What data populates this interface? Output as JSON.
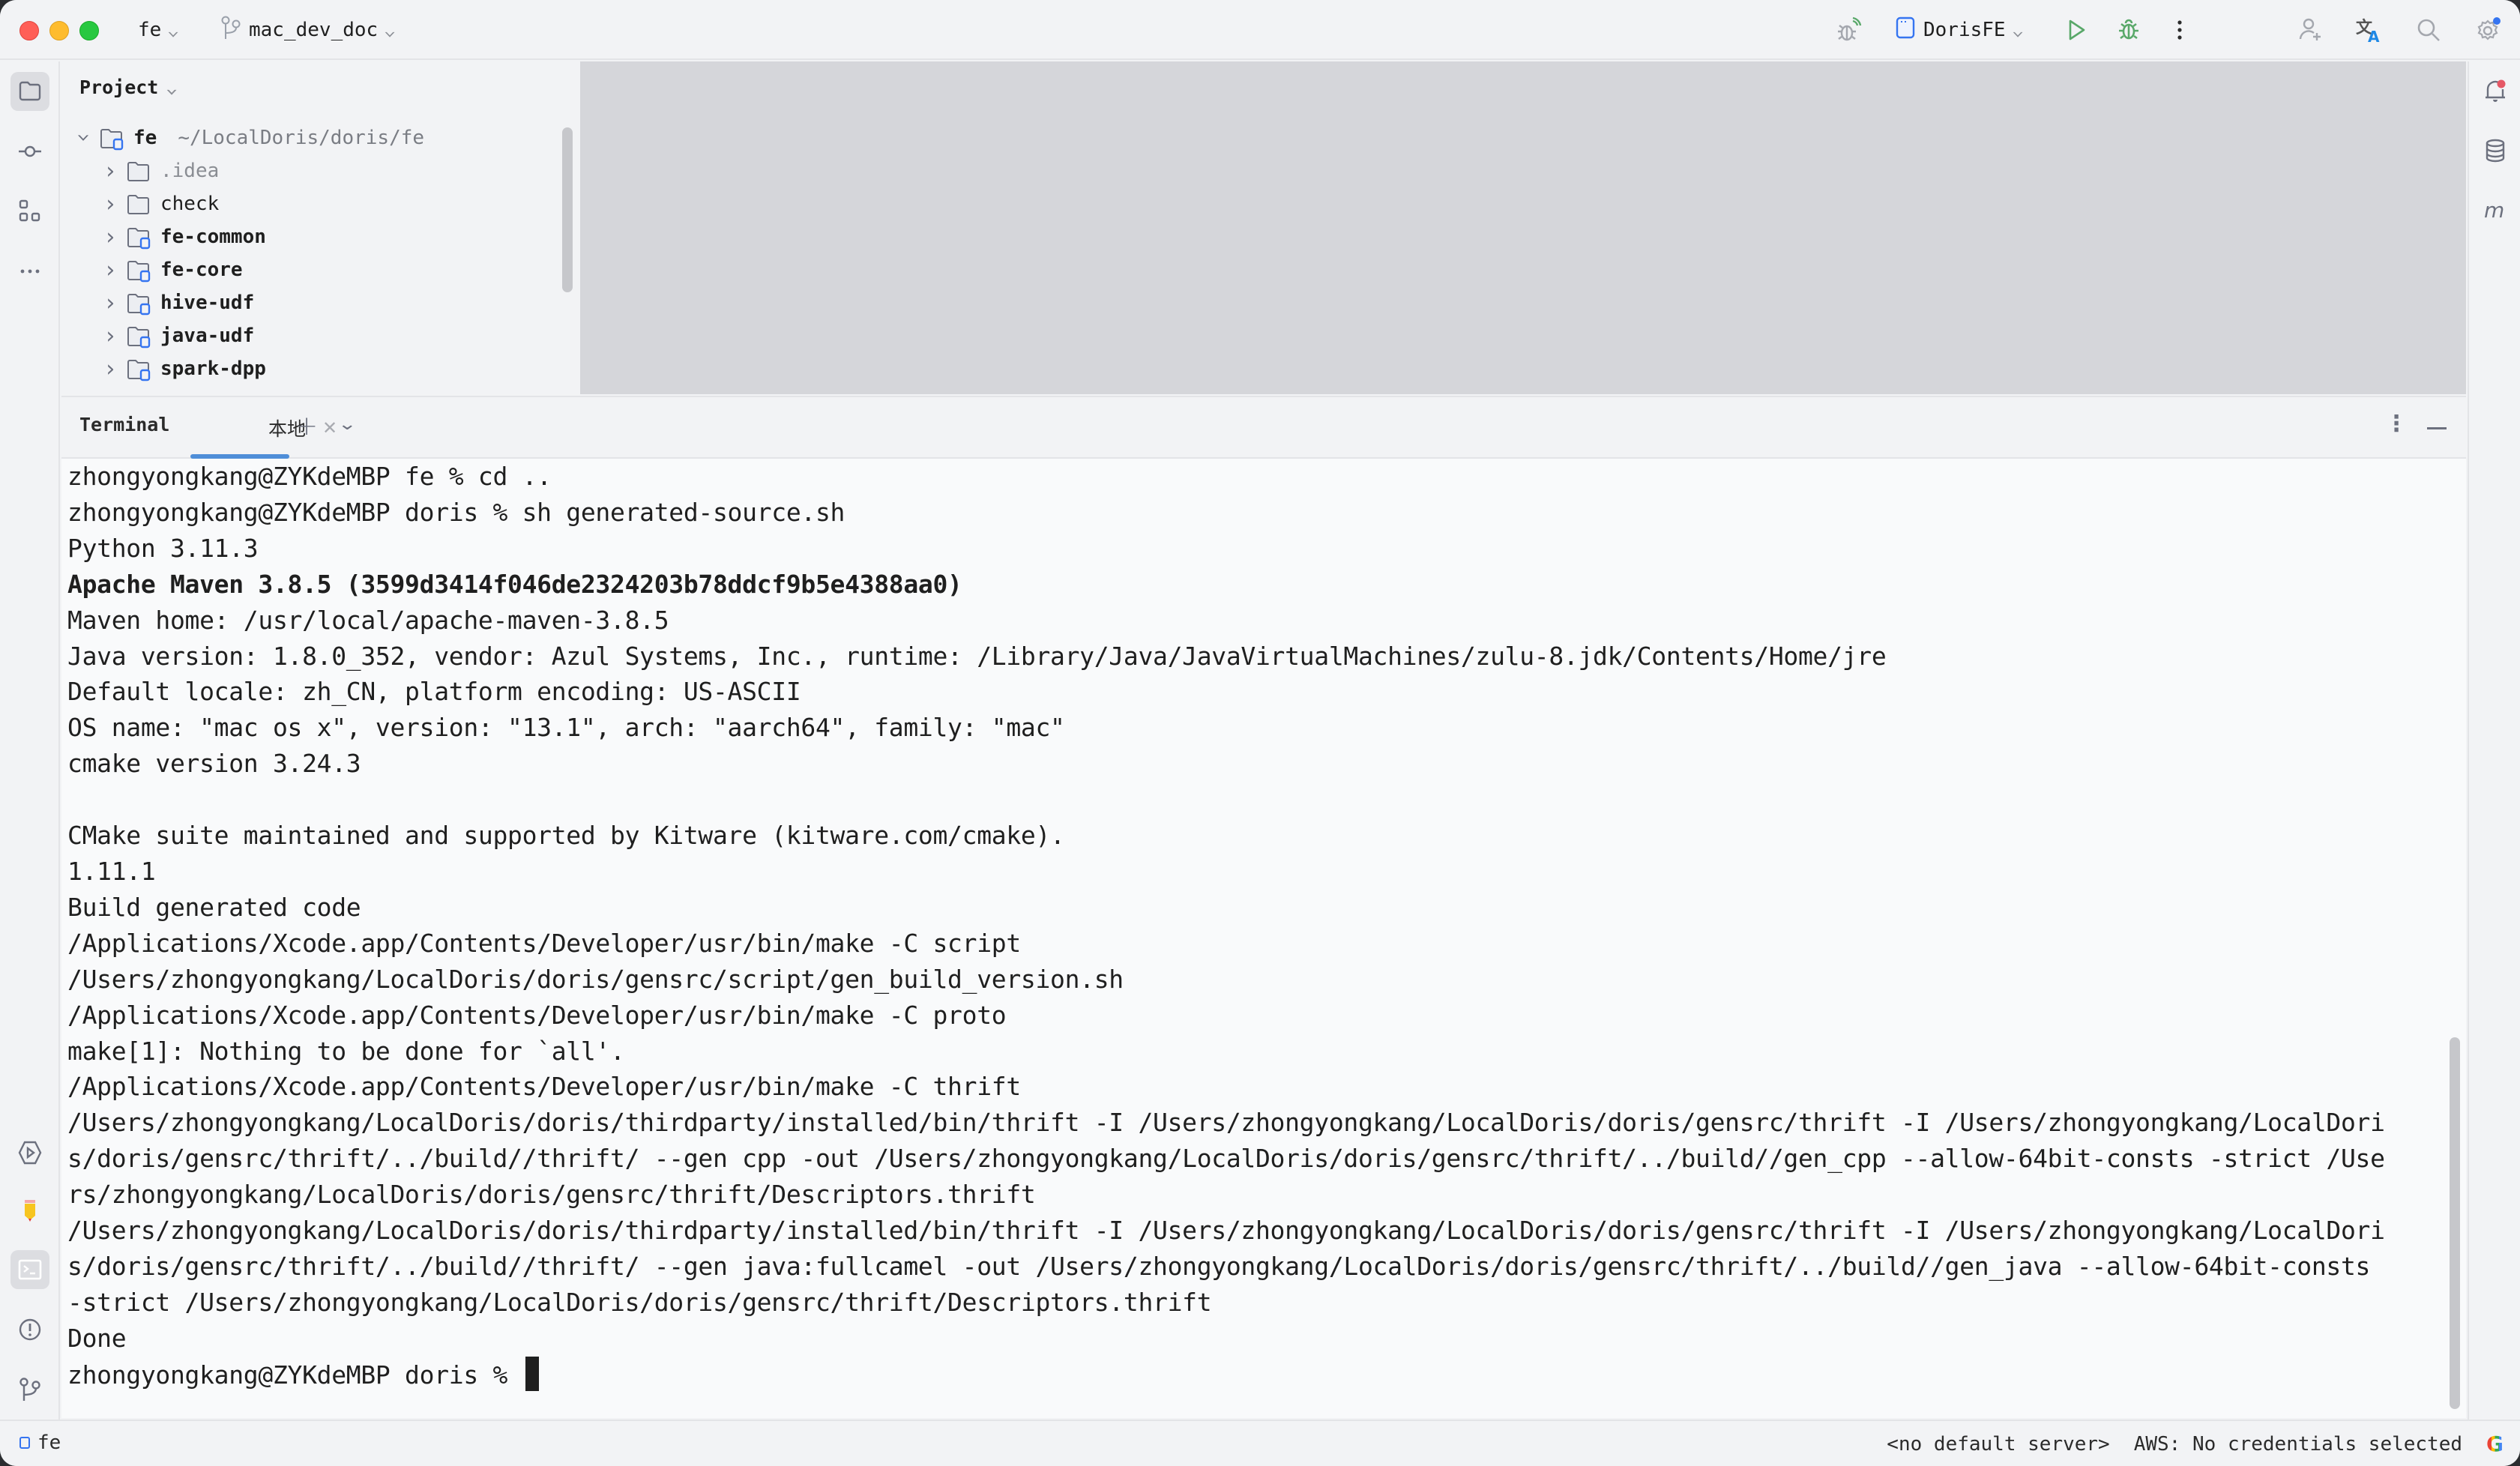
{
  "titlebar": {
    "project_name": "fe",
    "branch_name": "mac_dev_doc",
    "run_config": "DorisFE"
  },
  "toolbar_icons": [
    "debug-remote-icon",
    "run-config-icon",
    "run-icon",
    "debug-icon",
    "more-icon",
    "add-user-icon",
    "translate-icon",
    "search-icon",
    "settings-icon"
  ],
  "left_strip": {
    "top": [
      "project-icon",
      "commit-icon",
      "structure-icon",
      "more-tools-icon"
    ],
    "bottom": [
      "services-icon",
      "plugin-pencil-icon",
      "terminal-icon",
      "problems-icon",
      "git-icon"
    ]
  },
  "right_strip": [
    "notifications-icon",
    "database-icon",
    "maven-icon"
  ],
  "project_panel": {
    "title": "Project",
    "tree": [
      {
        "name": "fe",
        "hint": "~/LocalDoris/doris/fe",
        "expanded": true,
        "level": 0,
        "style": "bold",
        "module": true
      },
      {
        "name": ".idea",
        "level": 1,
        "style": "muted",
        "module": false
      },
      {
        "name": "check",
        "level": 1,
        "style": "normal",
        "module": false
      },
      {
        "name": "fe-common",
        "level": 1,
        "style": "bold",
        "module": true
      },
      {
        "name": "fe-core",
        "level": 1,
        "style": "bold",
        "module": true
      },
      {
        "name": "hive-udf",
        "level": 1,
        "style": "bold",
        "module": true
      },
      {
        "name": "java-udf",
        "level": 1,
        "style": "bold",
        "module": true
      },
      {
        "name": "spark-dpp",
        "level": 1,
        "style": "bold",
        "module": true
      }
    ]
  },
  "terminal": {
    "title": "Terminal",
    "tabs": [
      {
        "label": "本地",
        "active": true
      }
    ],
    "lines": [
      {
        "text": "zhongyongkang@ZYKdeMBP fe % cd ..",
        "bold": false
      },
      {
        "text": "zhongyongkang@ZYKdeMBP doris % sh generated-source.sh",
        "bold": false
      },
      {
        "text": "Python 3.11.3",
        "bold": false
      },
      {
        "text": "Apache Maven 3.8.5 (3599d3414f046de2324203b78ddcf9b5e4388aa0)",
        "bold": true
      },
      {
        "text": "Maven home: /usr/local/apache-maven-3.8.5",
        "bold": false
      },
      {
        "text": "Java version: 1.8.0_352, vendor: Azul Systems, Inc., runtime: /Library/Java/JavaVirtualMachines/zulu-8.jdk/Contents/Home/jre",
        "bold": false
      },
      {
        "text": "Default locale: zh_CN, platform encoding: US-ASCII",
        "bold": false
      },
      {
        "text": "OS name: \"mac os x\", version: \"13.1\", arch: \"aarch64\", family: \"mac\"",
        "bold": false
      },
      {
        "text": "cmake version 3.24.3",
        "bold": false
      },
      {
        "text": "",
        "bold": false
      },
      {
        "text": "CMake suite maintained and supported by Kitware (kitware.com/cmake).",
        "bold": false
      },
      {
        "text": "1.11.1",
        "bold": false
      },
      {
        "text": "Build generated code",
        "bold": false
      },
      {
        "text": "/Applications/Xcode.app/Contents/Developer/usr/bin/make -C script",
        "bold": false
      },
      {
        "text": "/Users/zhongyongkang/LocalDoris/doris/gensrc/script/gen_build_version.sh",
        "bold": false
      },
      {
        "text": "/Applications/Xcode.app/Contents/Developer/usr/bin/make -C proto",
        "bold": false
      },
      {
        "text": "make[1]: Nothing to be done for `all'.",
        "bold": false
      },
      {
        "text": "/Applications/Xcode.app/Contents/Developer/usr/bin/make -C thrift",
        "bold": false
      },
      {
        "text": "/Users/zhongyongkang/LocalDoris/doris/thirdparty/installed/bin/thrift -I /Users/zhongyongkang/LocalDoris/doris/gensrc/thrift -I /Users/zhongyongkang/LocalDori",
        "bold": false
      },
      {
        "text": "s/doris/gensrc/thrift/../build//thrift/ --gen cpp -out /Users/zhongyongkang/LocalDoris/doris/gensrc/thrift/../build//gen_cpp --allow-64bit-consts -strict /Use",
        "bold": false
      },
      {
        "text": "rs/zhongyongkang/LocalDoris/doris/gensrc/thrift/Descriptors.thrift",
        "bold": false
      },
      {
        "text": "/Users/zhongyongkang/LocalDoris/doris/thirdparty/installed/bin/thrift -I /Users/zhongyongkang/LocalDoris/doris/gensrc/thrift -I /Users/zhongyongkang/LocalDori",
        "bold": false
      },
      {
        "text": "s/doris/gensrc/thrift/../build//thrift/ --gen java:fullcamel -out /Users/zhongyongkang/LocalDoris/doris/gensrc/thrift/../build//gen_java --allow-64bit-consts",
        "bold": false
      },
      {
        "text": "-strict /Users/zhongyongkang/LocalDoris/doris/gensrc/thrift/Descriptors.thrift",
        "bold": false
      },
      {
        "text": "Done",
        "bold": false
      }
    ],
    "prompt": "zhongyongkang@ZYKdeMBP doris % "
  },
  "statusbar": {
    "module": "fe",
    "server": "<no default server>",
    "aws": "AWS: No credentials selected",
    "google_label": "G"
  },
  "colors": {
    "accent": "#3574f0",
    "tab_underline": "#4f8ed8",
    "run_green": "#59a869",
    "notification_red": "#e55765"
  }
}
